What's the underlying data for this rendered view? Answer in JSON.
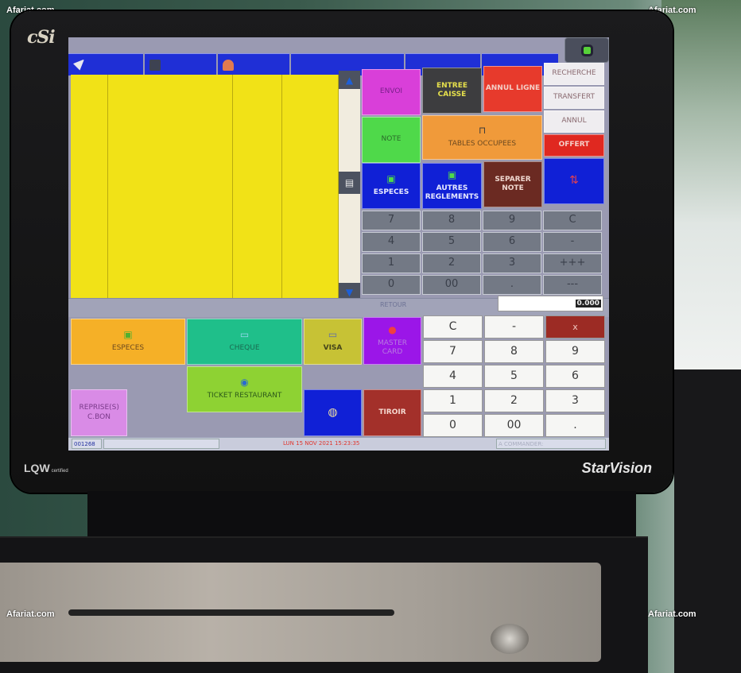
{
  "watermark": "Afariat.com",
  "bezel": {
    "brand_top": "cSi",
    "brand_bottom_left": "LQW",
    "brand_bottom_left_sub": "certified",
    "brand_bottom_right": "StarVision"
  },
  "topbar": {
    "tabs": [
      {
        "label": "",
        "icon": "bird-icon"
      },
      {
        "label": "",
        "icon": "pause-icon"
      },
      {
        "label": "",
        "icon": "waiter-icon"
      },
      {
        "label": ""
      },
      {
        "label": ""
      },
      {
        "label": ""
      }
    ],
    "status_indicator": "green-status-icon"
  },
  "ticket": {
    "columns": 5
  },
  "actions": {
    "envoi": "ENVOI",
    "entree_caisse": "ENTREE CAISSE",
    "annul_ligne": "ANNUL LIGNE",
    "recherche": "RECHERCHE",
    "transfert": "TRANSFERT",
    "annul": "ANNUL",
    "offert": "OFFERT",
    "note": "NOTE",
    "tables_occupees": "TABLES OCCUPEES",
    "especes": "ESPECES",
    "autres_reglements": "AUTRES REGLEMENTS",
    "separer_note": "SEPARER NOTE"
  },
  "keypad_top": [
    "7",
    "8",
    "9",
    "C",
    "4",
    "5",
    "6",
    "-",
    "1",
    "2",
    "3",
    "+++",
    "0",
    "00",
    ".",
    "---"
  ],
  "retour": {
    "label": "RETOUR",
    "value": "0.000"
  },
  "payments": {
    "especes": "ESPECES",
    "cheque": "CHEQUE",
    "visa": "VISA",
    "mastercard": "MASTER CARD",
    "ticket_restaurant": "TICKET RESTAURANT",
    "reprise": "REPRISE(S) C.BON",
    "tiroir": "TIROIR"
  },
  "keypad_bottom": [
    "C",
    "-",
    "x",
    "7",
    "8",
    "9",
    "4",
    "5",
    "6",
    "1",
    "2",
    "3",
    "0",
    "00",
    "."
  ],
  "statusbar": {
    "ticket_number": "001268",
    "datetime": "LUN 15 NOV 2021   15:23:35",
    "a_commander": "A COMMANDER:"
  },
  "colors": {
    "topbar_blue": "#1f2fd6",
    "ticket_yellow": "#f1e217",
    "envoi_magenta": "#d93fd9",
    "entree_caisse_dark": "#3d3d3f",
    "annul_ligne_red": "#e73a2c",
    "offert_red": "#e02820",
    "note_green": "#4fd94a",
    "tables_orange": "#f09a3a",
    "blue_btn": "#1020d6",
    "separer_brown": "#6b2a22",
    "especes_orange": "#f5b027",
    "cheque_teal": "#1fbf8a",
    "visa_olive": "#c7c235",
    "mastercard_purple": "#9b16e8",
    "ticket_resto_lime": "#8ed233",
    "reprise_pink": "#d98be6",
    "tiroir_brown": "#a3302a",
    "keypad_x": "#9c2b24"
  }
}
